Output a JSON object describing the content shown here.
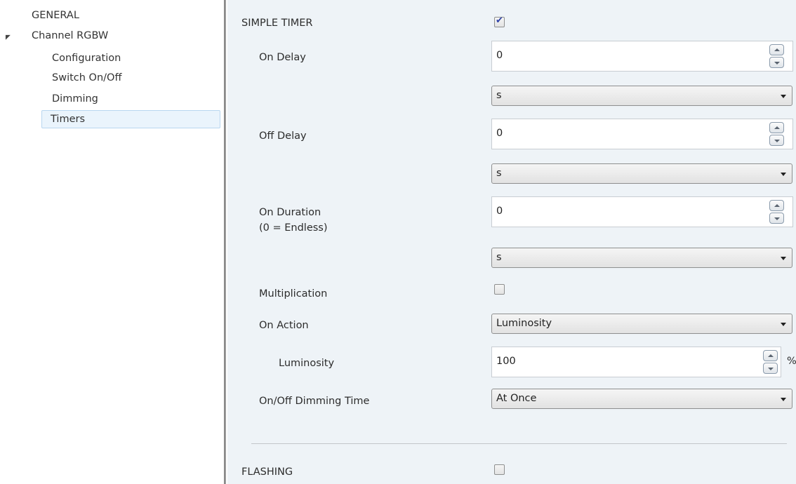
{
  "tree": {
    "items": [
      {
        "label": "GENERAL"
      },
      {
        "label": "Channel RGBW"
      },
      {
        "label": "Configuration"
      },
      {
        "label": "Switch On/Off"
      },
      {
        "label": "Dimming"
      },
      {
        "label": "Timers"
      }
    ],
    "expand_icon": "collapse-triangle-icon"
  },
  "simple_timer": {
    "label": "SIMPLE TIMER",
    "checked": true
  },
  "on_delay": {
    "label": "On Delay",
    "value": "0",
    "unit": "s"
  },
  "off_delay": {
    "label": "Off Delay",
    "value": "0",
    "unit": "s"
  },
  "on_duration": {
    "label": "On Duration",
    "sublabel": "(0 = Endless)",
    "value": "0",
    "unit": "s"
  },
  "multiplication": {
    "label": "Multiplication",
    "checked": false
  },
  "on_action": {
    "label": "On Action",
    "value": "Luminosity"
  },
  "luminosity": {
    "label": "Luminosity",
    "value": "100",
    "unit": "%"
  },
  "dimming_time": {
    "label": "On/Off Dimming Time",
    "value": "At Once"
  },
  "flashing": {
    "label": "FLASHING",
    "checked": false
  },
  "colors": {
    "panel_bg": "#eef3f7",
    "selection_bg": "#eaf4fc",
    "check_mark": "#2b3fa6"
  }
}
